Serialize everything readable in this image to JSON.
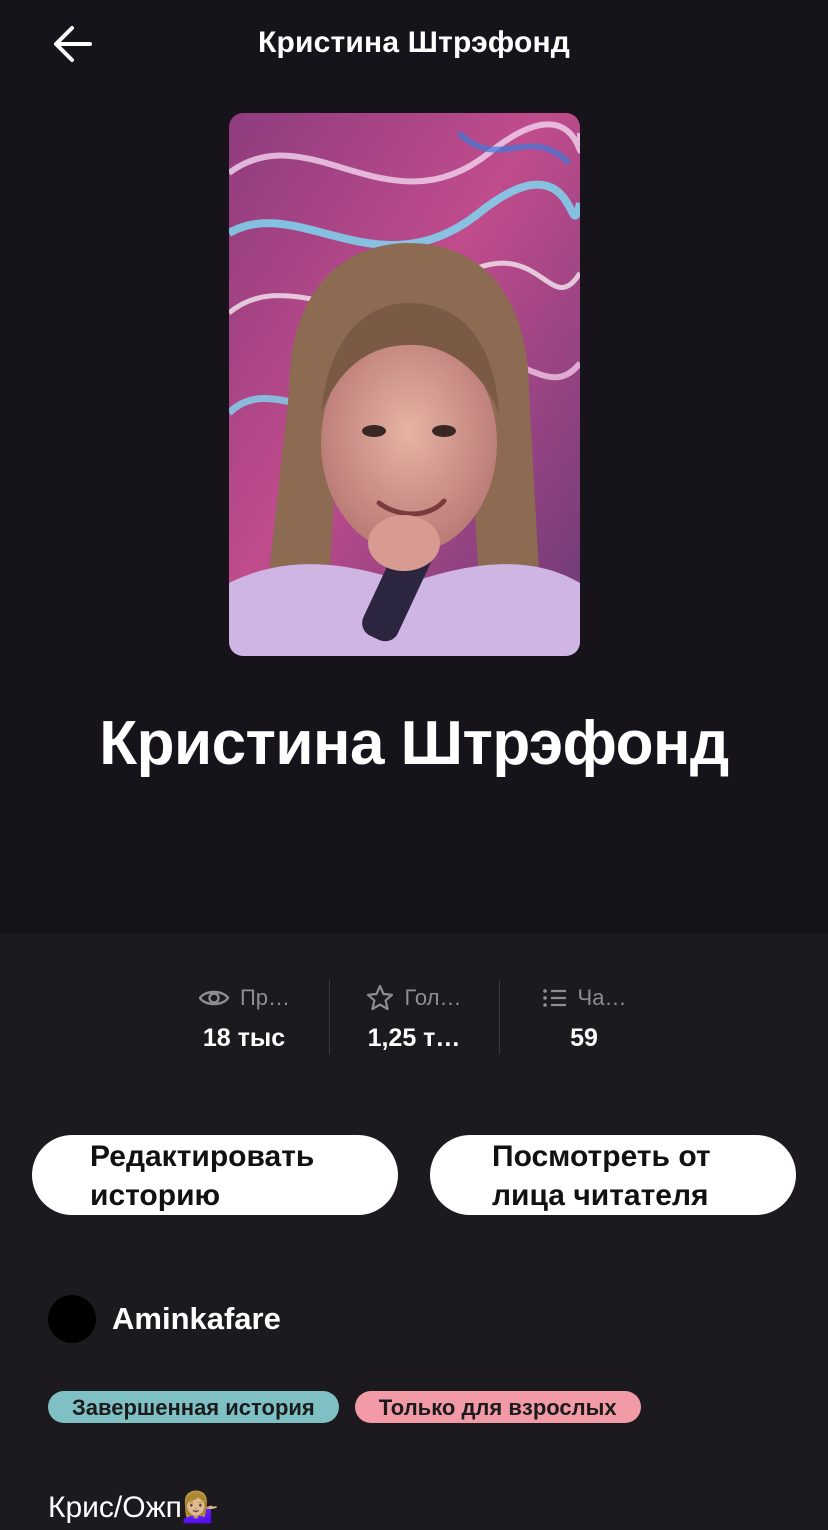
{
  "header": {
    "title": "Кристина Штрэфонд",
    "back_icon": "arrow-left-icon"
  },
  "story": {
    "title": "Кристина Штрэфонд"
  },
  "stats": [
    {
      "icon": "eye-icon",
      "label": "Пр…",
      "value": "18 тыс"
    },
    {
      "icon": "star-icon",
      "label": "Гол…",
      "value": "1,25 т…"
    },
    {
      "icon": "list-icon",
      "label": "Ча…",
      "value": "59"
    }
  ],
  "actions": {
    "edit_line1": "Редактировать",
    "edit_line2": "историю",
    "preview_line1": "Посмотреть от",
    "preview_line2": "лица читателя"
  },
  "author": {
    "name": "Aminkafare"
  },
  "tags": {
    "complete": "Завершенная история",
    "mature": "Только для взрослых"
  },
  "description": "Крис/Ожп💁🏼‍♀️",
  "colors": {
    "background": "#1c1a1e",
    "hero_background": "#16131a",
    "tag_complete": "#7fc0c5",
    "tag_mature": "#f29aa5",
    "button": "#ffffff"
  }
}
